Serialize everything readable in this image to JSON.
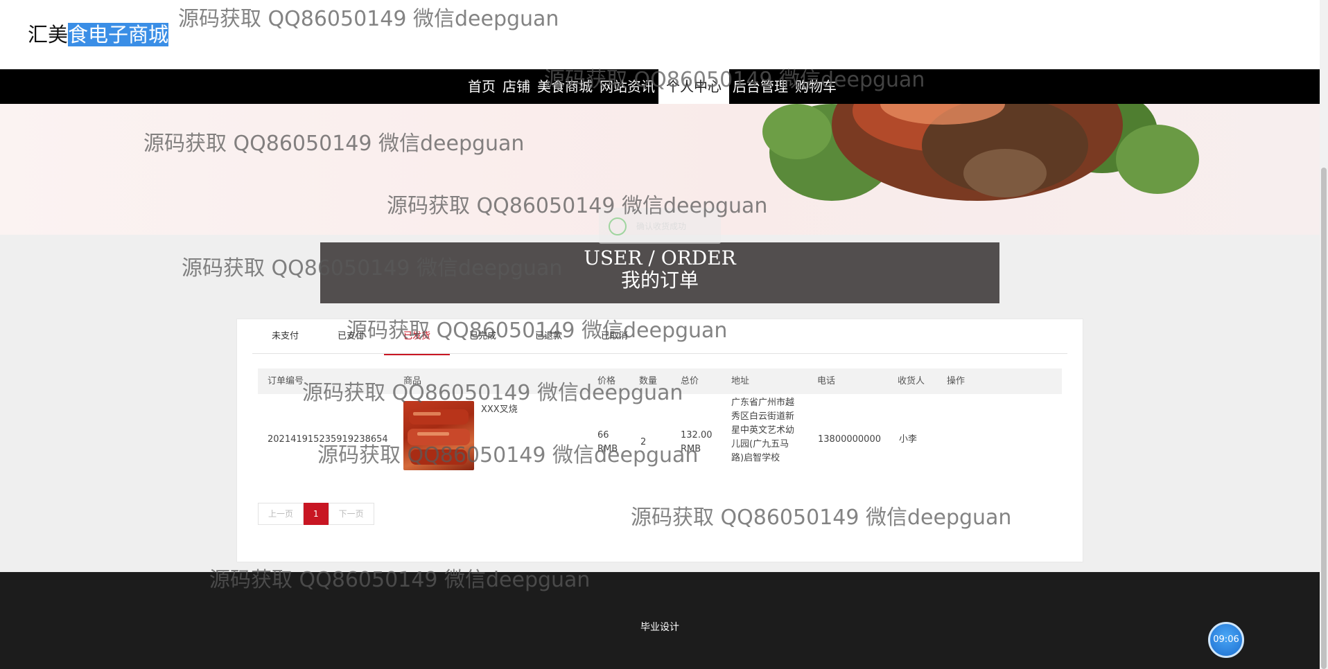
{
  "logo": {
    "part1": "汇美",
    "part2": "食电子商城"
  },
  "nav": [
    "首页",
    "店铺",
    "美食商城",
    "网站资讯",
    "个人中心",
    "后台管理",
    "购物车"
  ],
  "title": {
    "en": "USER / ORDER",
    "cn": "我的订单"
  },
  "tabs": [
    "未支付",
    "已支付",
    "已发货",
    "已完成",
    "已退款",
    "已取消"
  ],
  "columns": [
    "订单编号",
    "商品",
    "价格",
    "数量",
    "总价",
    "地址",
    "电话",
    "收货人",
    "操作"
  ],
  "order": {
    "id": "20214191523591923865​4",
    "product": "XXX叉烧",
    "price": "66 RMB",
    "qty": "2",
    "total": "132.00 RMB",
    "address": "广东省广州市越秀区白云街道新星中英文艺术幼儿园(广九五马路)启智学校",
    "phone": "13800000000",
    "receiver": "小李"
  },
  "pager": {
    "prev": "上一页",
    "current": "1",
    "next": "下一页"
  },
  "toast": "确认收货成功",
  "footer": "毕业设计",
  "clock": "09:06",
  "watermark": "源码获取 QQ86050149 微信deepguan"
}
